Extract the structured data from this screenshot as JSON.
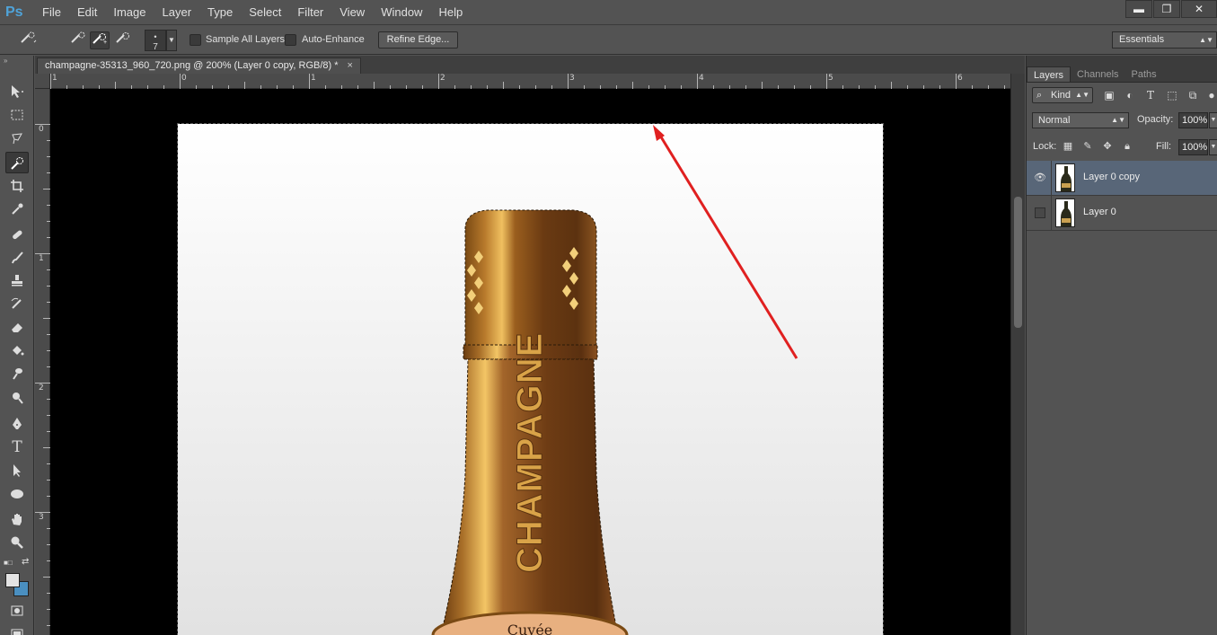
{
  "app": {
    "logo": "Ps"
  },
  "menu": [
    "File",
    "Edit",
    "Image",
    "Layer",
    "Type",
    "Select",
    "Filter",
    "View",
    "Window",
    "Help"
  ],
  "window_controls": {
    "minimize": "▬",
    "restore": "❐",
    "close": "✕"
  },
  "options": {
    "brush_size": "7",
    "sample_all_layers": "Sample All Layers",
    "auto_enhance": "Auto-Enhance",
    "refine_edge": "Refine Edge...",
    "workspace": "Essentials"
  },
  "document": {
    "tab_title": "champagne-35313_960_720.png @ 200% (Layer 0 copy, RGB/8) *",
    "close": "×"
  },
  "rulers": {
    "top_labels": [
      "1",
      "0",
      "1",
      "2",
      "3",
      "4",
      "5",
      "6"
    ],
    "left_labels": [
      "0",
      "1",
      "2",
      "3"
    ]
  },
  "image": {
    "bottle_text": "CHAMPAGNE",
    "label_text": "Cuvée"
  },
  "panel": {
    "tabs": [
      "Layers",
      "Channels",
      "Paths"
    ],
    "kind": "Kind",
    "blend_mode": "Normal",
    "opacity_label": "Opacity:",
    "opacity_value": "100%",
    "lock_label": "Lock:",
    "fill_label": "Fill:",
    "fill_value": "100%",
    "layers": [
      {
        "name": "Layer 0 copy",
        "visible": true,
        "selected": true
      },
      {
        "name": "Layer 0",
        "visible": false,
        "selected": false
      }
    ]
  },
  "colors": {
    "accent_arrow": "#e02020",
    "foreground": "#e3e3e3",
    "background": "#4a8fc0",
    "selected_layer": "#586678"
  }
}
